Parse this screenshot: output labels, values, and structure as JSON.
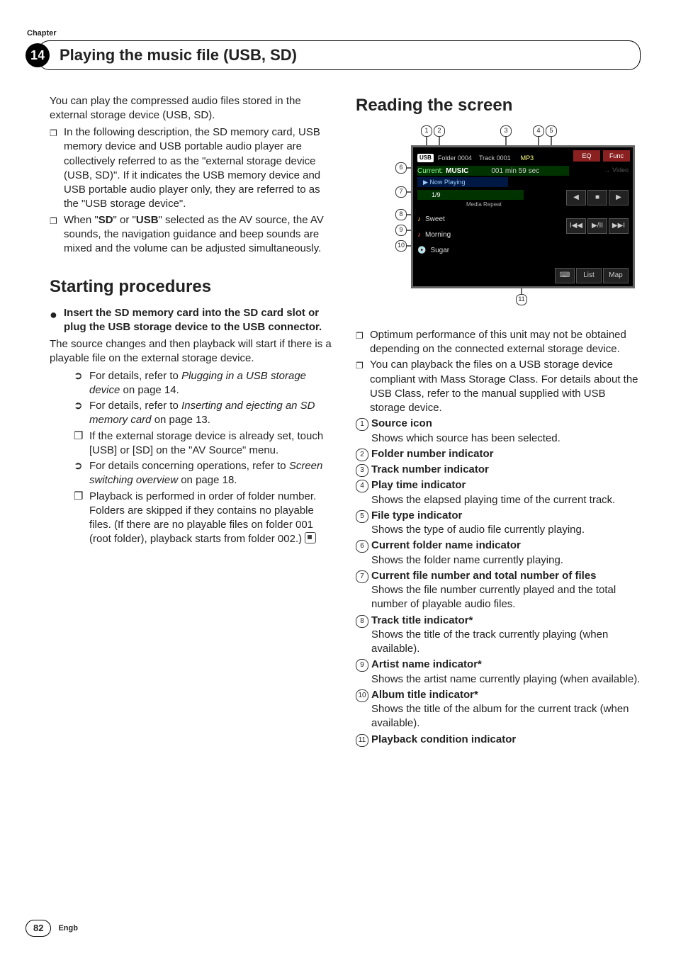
{
  "chapterLabel": "Chapter",
  "chapterNum": "14",
  "title": "Playing the music file (USB, SD)",
  "pageNum": "82",
  "lang": "Engb",
  "left": {
    "intro": "You can play the compressed audio files stored in the external storage device (USB, SD).",
    "b1": "In the following description, the SD memory card, USB memory device and USB portable audio player are collectively referred to as the \"external storage device (USB, SD)\". If it indicates the USB memory device and USB portable audio player only, they are referred to as the \"USB storage device\".",
    "b2a": "When \"",
    "b2b": "SD",
    "b2c": "\" or \"",
    "b2d": "USB",
    "b2e": "\" selected as the AV source, the AV sounds, the navigation guidance and beep sounds are mixed and the volume can be adjusted simultaneously.",
    "h2": "Starting procedures",
    "step": "Insert the SD memory card into the SD card slot or plug the USB storage device to the USB connector.",
    "after": "The source changes and then playback will start if there is a playable file on the external storage device.",
    "s1a": "For details, refer to ",
    "s1b": "Plugging in a USB storage device",
    "s1c": " on page 14.",
    "s2a": "For details, refer to ",
    "s2b": "Inserting and ejecting an SD memory card",
    "s2c": " on page 13.",
    "s3a": "If the external storage device is already set, touch [",
    "s3b": "USB",
    "s3c": "] or [",
    "s3d": "SD",
    "s3e": "] on the \"",
    "s3f": "AV Source",
    "s3g": "\" menu.",
    "s4a": "For details concerning operations, refer to ",
    "s4b": "Screen switching overview",
    "s4c": " on page 18.",
    "s5": "Playback is performed in order of folder number. Folders are skipped if they contains no playable files. (If there are no playable files on folder 001 (root folder), playback starts from folder 002.)"
  },
  "right": {
    "h2": "Reading the screen",
    "notes1": "Optimum performance of this unit may not be obtained depending on the connected external storage device.",
    "notes2": "You can playback the files on a USB storage device compliant with Mass Storage Class. For details about the USB Class, refer to the manual supplied with USB storage device.",
    "items": [
      {
        "n": "1",
        "t": "Source icon",
        "d": "Shows which source has been selected."
      },
      {
        "n": "2",
        "t": "Folder number indicator",
        "d": ""
      },
      {
        "n": "3",
        "t": "Track number indicator",
        "d": ""
      },
      {
        "n": "4",
        "t": "Play time indicator",
        "d": "Shows the elapsed playing time of the current track."
      },
      {
        "n": "5",
        "t": "File type indicator",
        "d": "Shows the type of audio file currently playing."
      },
      {
        "n": "6",
        "t": "Current folder name indicator",
        "d": "Shows the folder name currently playing."
      },
      {
        "n": "7",
        "t": "Current file number and total number of files",
        "d": "Shows the file number currently played and the total number of playable audio files."
      },
      {
        "n": "8",
        "t": "Track title indicator*",
        "d": "Shows the title of the track currently playing (when available)."
      },
      {
        "n": "9",
        "t": "Artist name indicator*",
        "d": "Shows the artist name currently playing (when available)."
      },
      {
        "n": "10",
        "t": "Album title indicator*",
        "d": "Shows the title of the album for the current track (when available)."
      },
      {
        "n": "11",
        "t": "Playback condition indicator",
        "d": ""
      }
    ]
  },
  "screen": {
    "usb": "USB",
    "folder": "Folder 0004",
    "track": "Track 0001",
    "type": "MP3",
    "eq": "EQ",
    "func": "Func",
    "curLabel": "Current:",
    "curVal": "MUSIC",
    "time": "001 min 59 sec",
    "vid": "→ Video",
    "now": "▶  Now Playing",
    "prog": "1/9",
    "rpt": "Media Repeat",
    "row8": "Sweet",
    "row9": "Morning",
    "row10": "Sugar",
    "list": "List",
    "map": "Map"
  }
}
